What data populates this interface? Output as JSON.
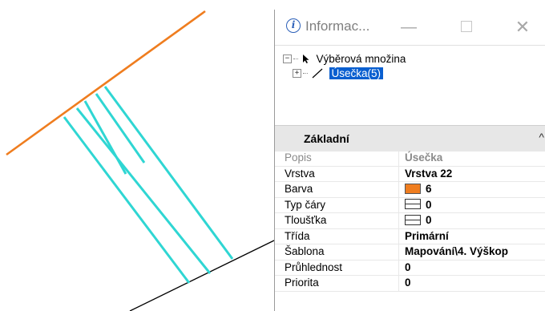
{
  "window": {
    "title": "Informac..."
  },
  "tree": {
    "root": {
      "label": "Výběrová množina",
      "icon": "pointer-icon"
    },
    "child": {
      "label": "Úsečka(5)",
      "icon": "line-icon",
      "selected": true
    }
  },
  "section": {
    "title": "Základní"
  },
  "properties": [
    {
      "label": "Popis",
      "value": "Úsečka",
      "muted": true
    },
    {
      "label": "Vrstva",
      "value": "Vrstva 22"
    },
    {
      "label": "Barva",
      "value": "6",
      "swatch": "#ef7d1f"
    },
    {
      "label": "Typ čáry",
      "value": "0",
      "icon": "linestyle-icon"
    },
    {
      "label": "Tloušťka",
      "value": "0",
      "icon": "lineweight-icon"
    },
    {
      "label": "Třída",
      "value": "Primární"
    },
    {
      "label": "Šablona",
      "value": "Mapování\\4. Výškop"
    },
    {
      "label": "Průhlednost",
      "value": "0"
    },
    {
      "label": "Priorita",
      "value": "0"
    }
  ],
  "colors": {
    "orange_line": "#ef7d1f",
    "cyan_lines": "#2fd6d3",
    "black_line": "#000000",
    "selection": "#0a5fd0"
  }
}
